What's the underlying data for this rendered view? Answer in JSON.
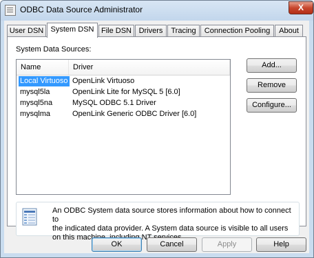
{
  "window": {
    "title": "ODBC Data Source Administrator",
    "close_label": "X"
  },
  "tabs": [
    {
      "label": "User DSN"
    },
    {
      "label": "System DSN"
    },
    {
      "label": "File DSN"
    },
    {
      "label": "Drivers"
    },
    {
      "label": "Tracing"
    },
    {
      "label": "Connection Pooling"
    },
    {
      "label": "About"
    }
  ],
  "active_tab": "System DSN",
  "section_label": "System Data Sources:",
  "list": {
    "columns": [
      "Name",
      "Driver"
    ],
    "rows": [
      {
        "name": "Local Virtuoso",
        "driver": "OpenLink Virtuoso",
        "selected": true
      },
      {
        "name": "mysql5la",
        "driver": "OpenLink Lite for MySQL 5 [6.0]"
      },
      {
        "name": "mysql5na",
        "driver": "MySQL ODBC 5.1 Driver"
      },
      {
        "name": "mysqlma",
        "driver": "OpenLink Generic ODBC Driver [6.0]"
      }
    ]
  },
  "side_buttons": {
    "add": "Add...",
    "remove": "Remove",
    "configure": "Configure..."
  },
  "info": {
    "icon": "data-source-icon",
    "lines": [
      "An ODBC System data source stores information about how to connect to",
      "the indicated data provider.   A System data source is visible to all users",
      "on this machine, including NT services."
    ]
  },
  "bottom_buttons": {
    "ok": "OK",
    "cancel": "Cancel",
    "apply": "Apply",
    "help": "Help"
  },
  "colors": {
    "selection": "#3399ff",
    "titlebar": "#c9dcef",
    "close": "#c7472e"
  }
}
